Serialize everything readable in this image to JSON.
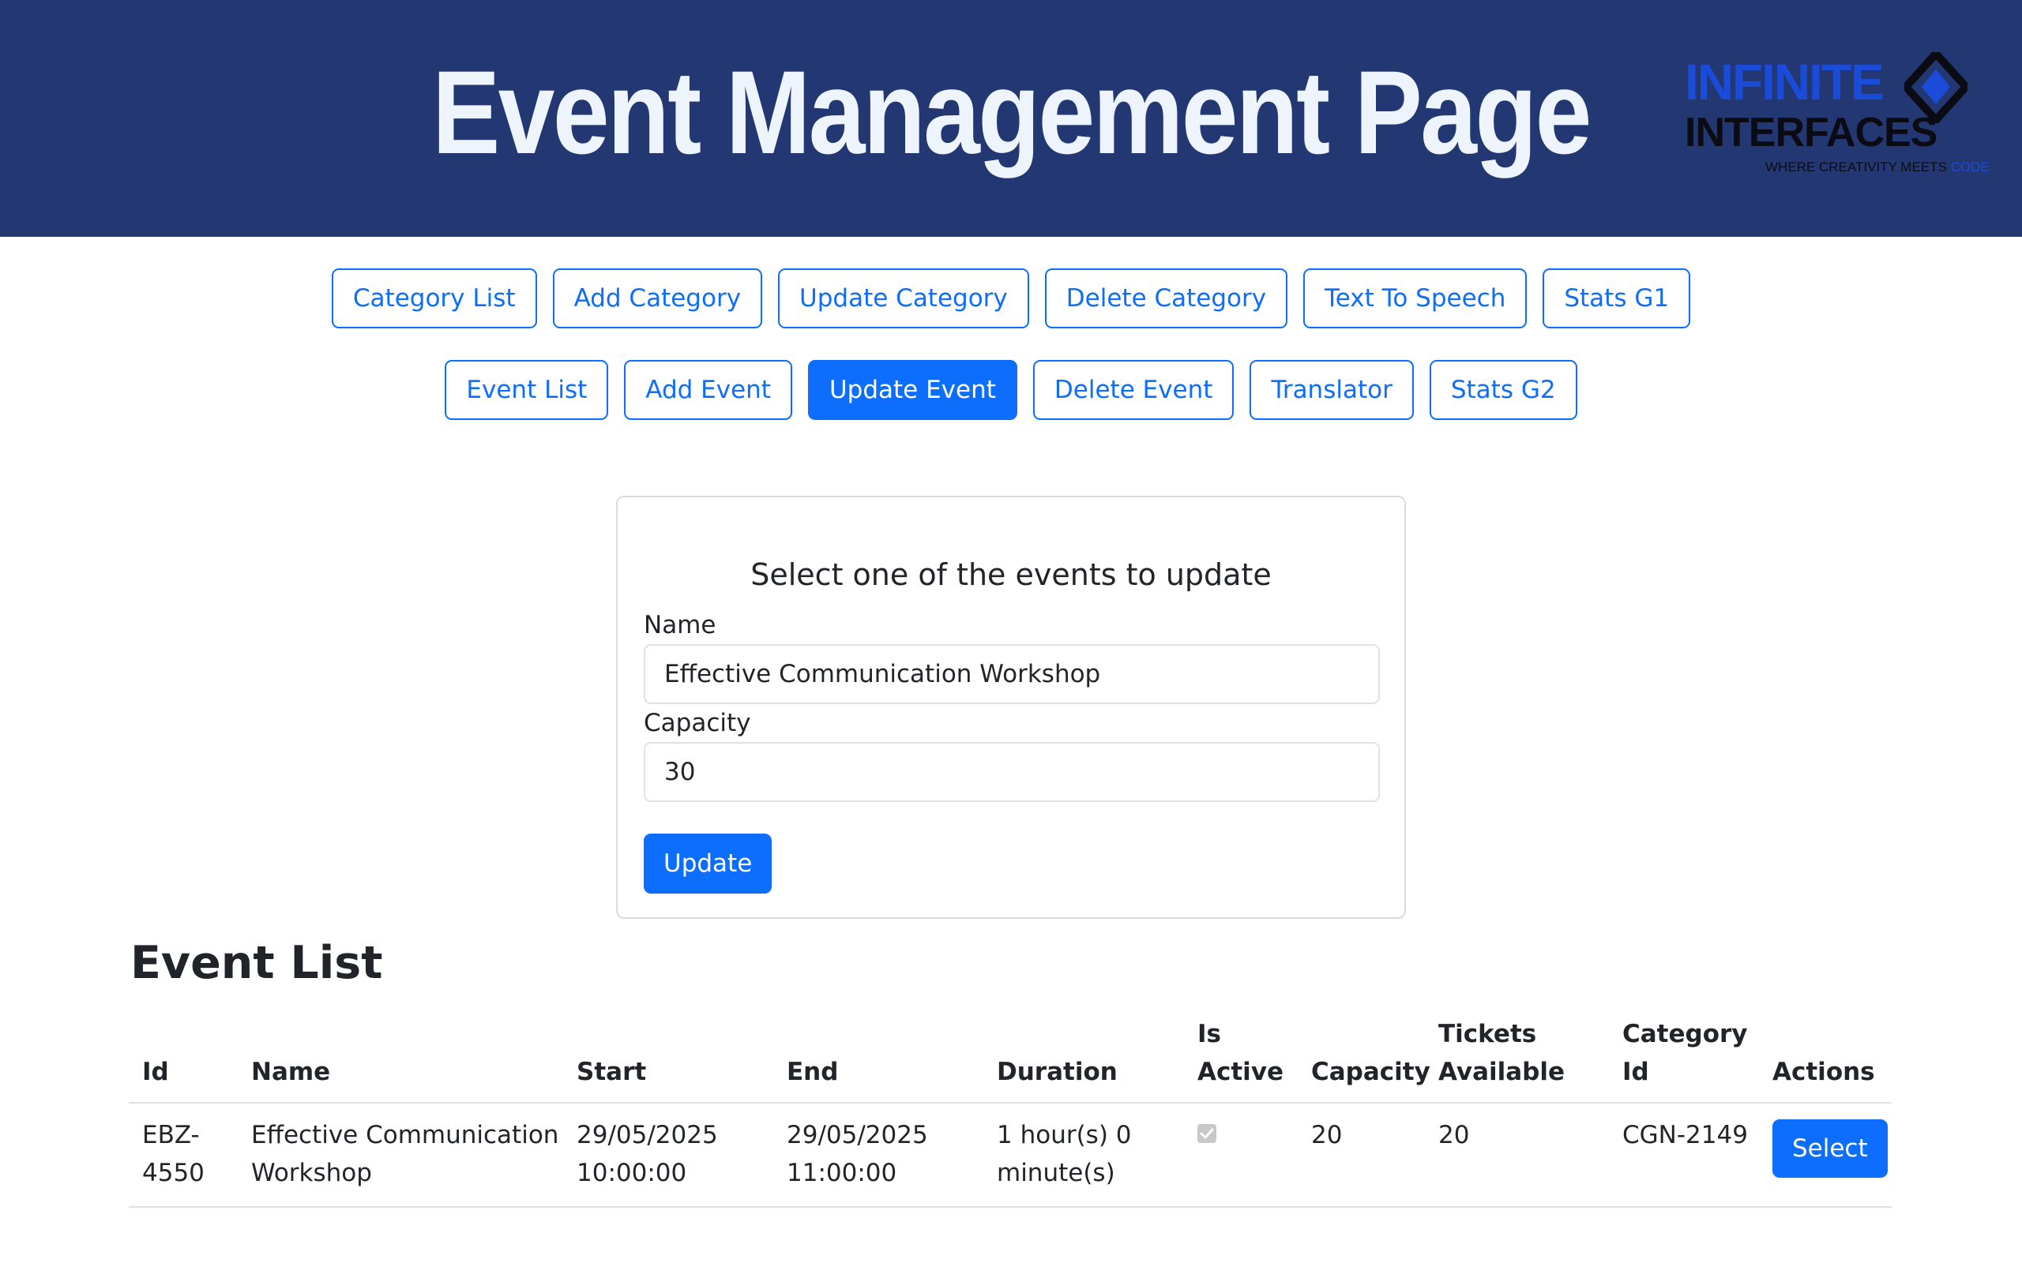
{
  "header": {
    "title": "Event Management Page",
    "logo": {
      "line1": "INFINITE",
      "line2": "INTERFACES",
      "tagline": "WHERE CREATIVITY MEETS",
      "tagline_accent": "CODE"
    }
  },
  "nav": {
    "row1": [
      "Category List",
      "Add Category",
      "Update Category",
      "Delete Category",
      "Text To Speech",
      "Stats G1"
    ],
    "row2": [
      "Event List",
      "Add Event",
      "Update Event",
      "Delete Event",
      "Translator",
      "Stats G2"
    ],
    "active": "Update Event"
  },
  "form": {
    "title": "Select one of the events to update",
    "name_label": "Name",
    "name_value": "Effective Communication Workshop",
    "capacity_label": "Capacity",
    "capacity_value": "30",
    "update_label": "Update"
  },
  "event_list": {
    "title": "Event List",
    "columns": {
      "id": "Id",
      "name": "Name",
      "start": "Start",
      "end": "End",
      "duration": "Duration",
      "is_active_1": "Is",
      "is_active_2": "Active",
      "capacity": "Capacity",
      "tickets_1": "Tickets",
      "tickets_2": "Available",
      "category_1": "Category",
      "category_2": "Id",
      "actions": "Actions"
    },
    "rows": [
      {
        "id_1": "EBZ-",
        "id_2": "4550",
        "name_1": "Effective Communication",
        "name_2": "Workshop",
        "start_1": "29/05/2025",
        "start_2": "10:00:00",
        "end_1": "29/05/2025",
        "end_2": "11:00:00",
        "duration_1": "1 hour(s) 0",
        "duration_2": "minute(s)",
        "is_active": true,
        "capacity": "20",
        "tickets_available": "20",
        "category_id": "CGN-2149",
        "action_label": "Select"
      }
    ]
  },
  "colors": {
    "header_bg": "#233872",
    "header_text": "#eef4fc",
    "primary": "#0d6efd",
    "logo_blue": "#1a4bd9"
  }
}
